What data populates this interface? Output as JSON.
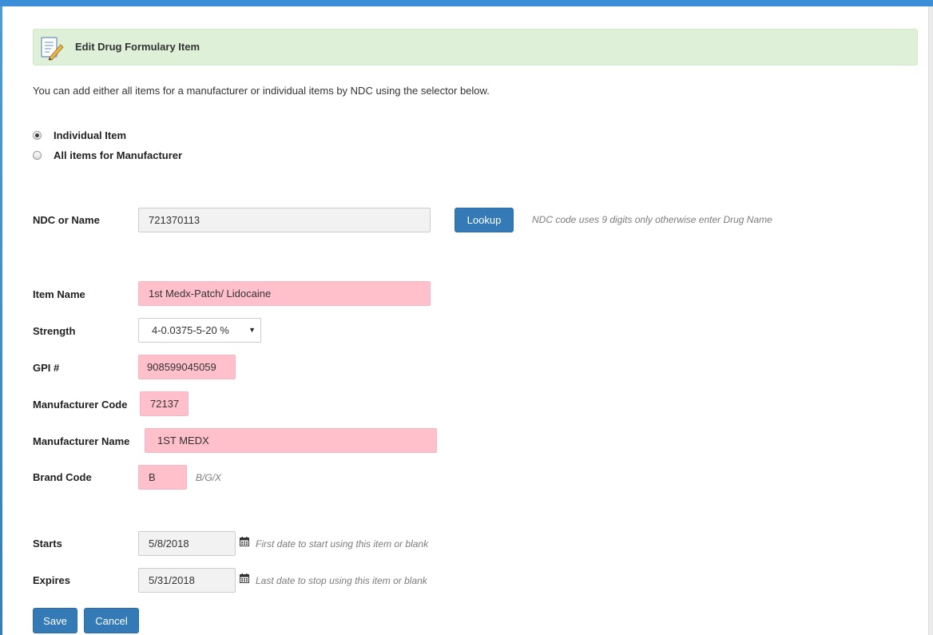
{
  "header": {
    "title": "Edit Drug Formulary Item",
    "icon": "edit-document-icon"
  },
  "intro": "You can add either all items for a manufacturer or individual items by NDC using the selector below.",
  "mode": {
    "options": [
      {
        "label": "Individual Item",
        "checked": true
      },
      {
        "label": "All items for Manufacturer",
        "checked": false
      }
    ]
  },
  "ndc": {
    "label": "NDC or Name",
    "value": "721370113",
    "lookup_label": "Lookup",
    "hint": "NDC code uses 9 digits only otherwise enter Drug Name"
  },
  "item": {
    "name_label": "Item Name",
    "name_value": "1st Medx-Patch/ Lidocaine",
    "strength_label": "Strength",
    "strength_value": "4-0.0375-5-20 %",
    "gpi_label": "GPI #",
    "gpi_value": "908599045059",
    "mfr_code_label": "Manufacturer Code",
    "mfr_code_value": "72137",
    "mfr_name_label": "Manufacturer Name",
    "mfr_name_value": "1ST MEDX",
    "brand_label": "Brand Code",
    "brand_value": "B",
    "brand_hint": "B/G/X"
  },
  "dates": {
    "starts_label": "Starts",
    "starts_value": "5/8/2018",
    "starts_hint": "First date to start using this item or blank",
    "expires_label": "Expires",
    "expires_value": "5/31/2018",
    "expires_hint": "Last date to stop using this item or blank"
  },
  "actions": {
    "save_label": "Save",
    "cancel_label": "Cancel"
  },
  "colors": {
    "accent": "#337ab7",
    "header_bg": "#dff0d8",
    "required_field_bg": "#ffc0cb",
    "top_bar": "#3a8fd6"
  }
}
